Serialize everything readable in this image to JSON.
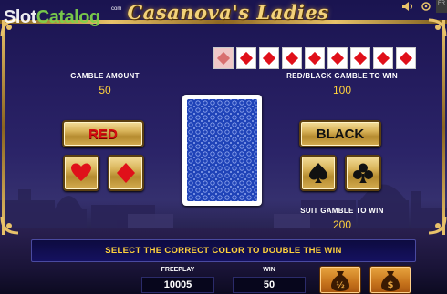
{
  "game": {
    "title": "Casanova's Ladies"
  },
  "watermark": {
    "brand_part1": "Slot",
    "brand_part2": "Catalog",
    "suffix": "com"
  },
  "top_right_tag": "FR",
  "history": {
    "cards": [
      {
        "suit": "diamond",
        "dim": true
      },
      {
        "suit": "diamond",
        "dim": false
      },
      {
        "suit": "diamond",
        "dim": false
      },
      {
        "suit": "diamond",
        "dim": false
      },
      {
        "suit": "diamond",
        "dim": false
      },
      {
        "suit": "diamond",
        "dim": false
      },
      {
        "suit": "diamond",
        "dim": false
      },
      {
        "suit": "diamond",
        "dim": false
      },
      {
        "suit": "diamond",
        "dim": false
      }
    ]
  },
  "gamble_amount": {
    "label": "GAMBLE AMOUNT",
    "value": "50"
  },
  "red_black_win": {
    "label": "RED/BLACK GAMBLE TO WIN",
    "value": "100"
  },
  "suit_win": {
    "label": "SUIT GAMBLE TO WIN",
    "value": "200"
  },
  "buttons": {
    "red": "RED",
    "black": "BLACK",
    "hearts": "heart-icon",
    "diamonds": "diamond-icon",
    "spades": "spade-icon",
    "clubs": "club-icon"
  },
  "message": "SELECT THE CORRECT COLOR TO DOUBLE THE WIN",
  "bottom": {
    "freeplay_label": "FREEPLAY",
    "freeplay_value": "10005",
    "win_label": "WIN",
    "win_value": "50",
    "half_collect_icon": "money-bag-half-icon",
    "collect_icon": "money-bag-dollar-icon",
    "half_label": "½"
  },
  "colors": {
    "gold": "#e8c26a",
    "value_yellow": "#ffd23c",
    "red": "#d60d10",
    "card_blue": "#1f43b8",
    "bag_orange": "#c7741c"
  }
}
